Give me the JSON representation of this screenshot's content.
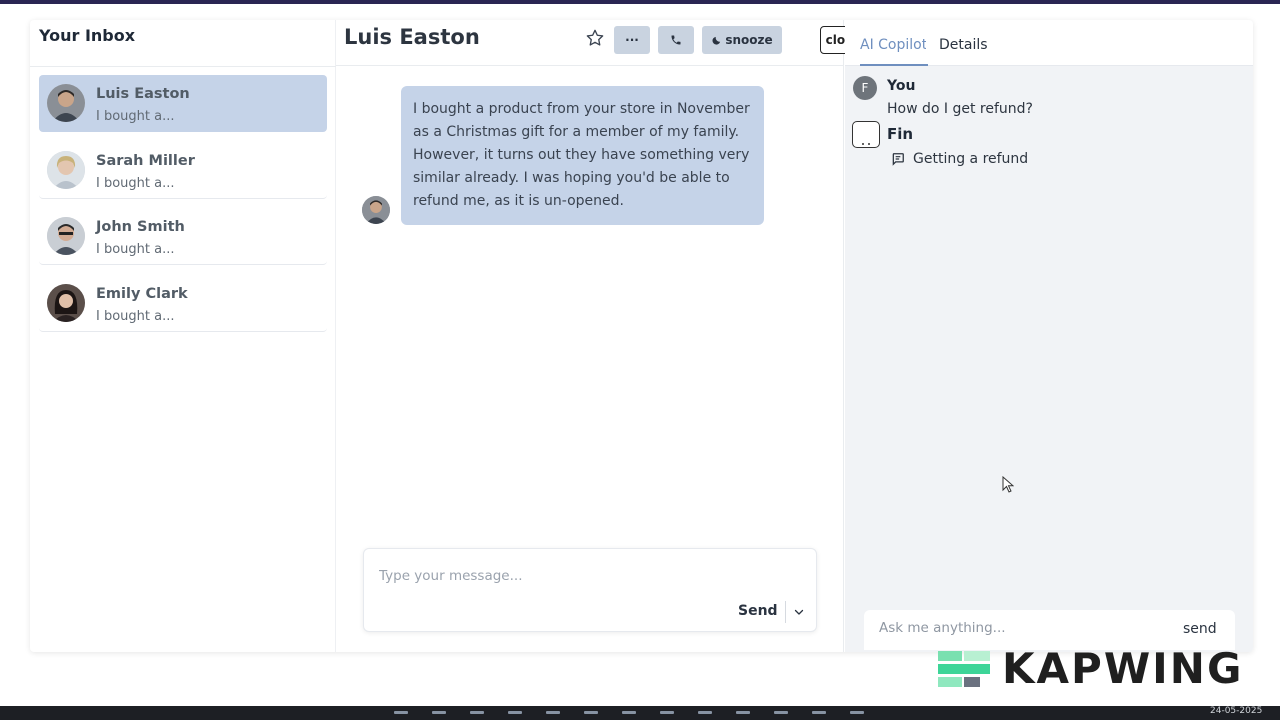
{
  "inbox": {
    "title": "Your Inbox",
    "conversations": [
      {
        "name": "Luis Easton",
        "preview": "I bought a...",
        "active": true
      },
      {
        "name": "Sarah Miller",
        "preview": "I bought a...",
        "active": false
      },
      {
        "name": "John Smith",
        "preview": "I bought a...",
        "active": false
      },
      {
        "name": "Emily Clark",
        "preview": "I bought a...",
        "active": false
      }
    ]
  },
  "conversation": {
    "title": "Luis Easton",
    "header_buttons": {
      "more_label": "···",
      "snooze_label": "snooze",
      "close_label": "close"
    },
    "message": "I bought a product from your store in November as a Christmas gift for a member of my family. However, it turns out they have something very similar already. I was hoping you'd be able to refund me, as it is un-opened.",
    "composer": {
      "placeholder": "Type your message...",
      "send_label": "Send"
    }
  },
  "copilot": {
    "tabs": [
      {
        "label": "AI Copilot",
        "active": true
      },
      {
        "label": "Details",
        "active": false
      }
    ],
    "you": {
      "initial": "F",
      "name": "You",
      "text": "How do I get refund?"
    },
    "fin": {
      "name": "Fin",
      "item": "Getting a refund"
    },
    "input": {
      "placeholder": "Ask me anything...",
      "send_label": "send"
    }
  },
  "watermark": {
    "text": "KAPWING"
  },
  "taskbar": {
    "clock": "24-05-2025"
  },
  "colors": {
    "accent": "#c5d3e8",
    "tab_active": "#6f8fbf",
    "top_bar": "#2a2553"
  }
}
